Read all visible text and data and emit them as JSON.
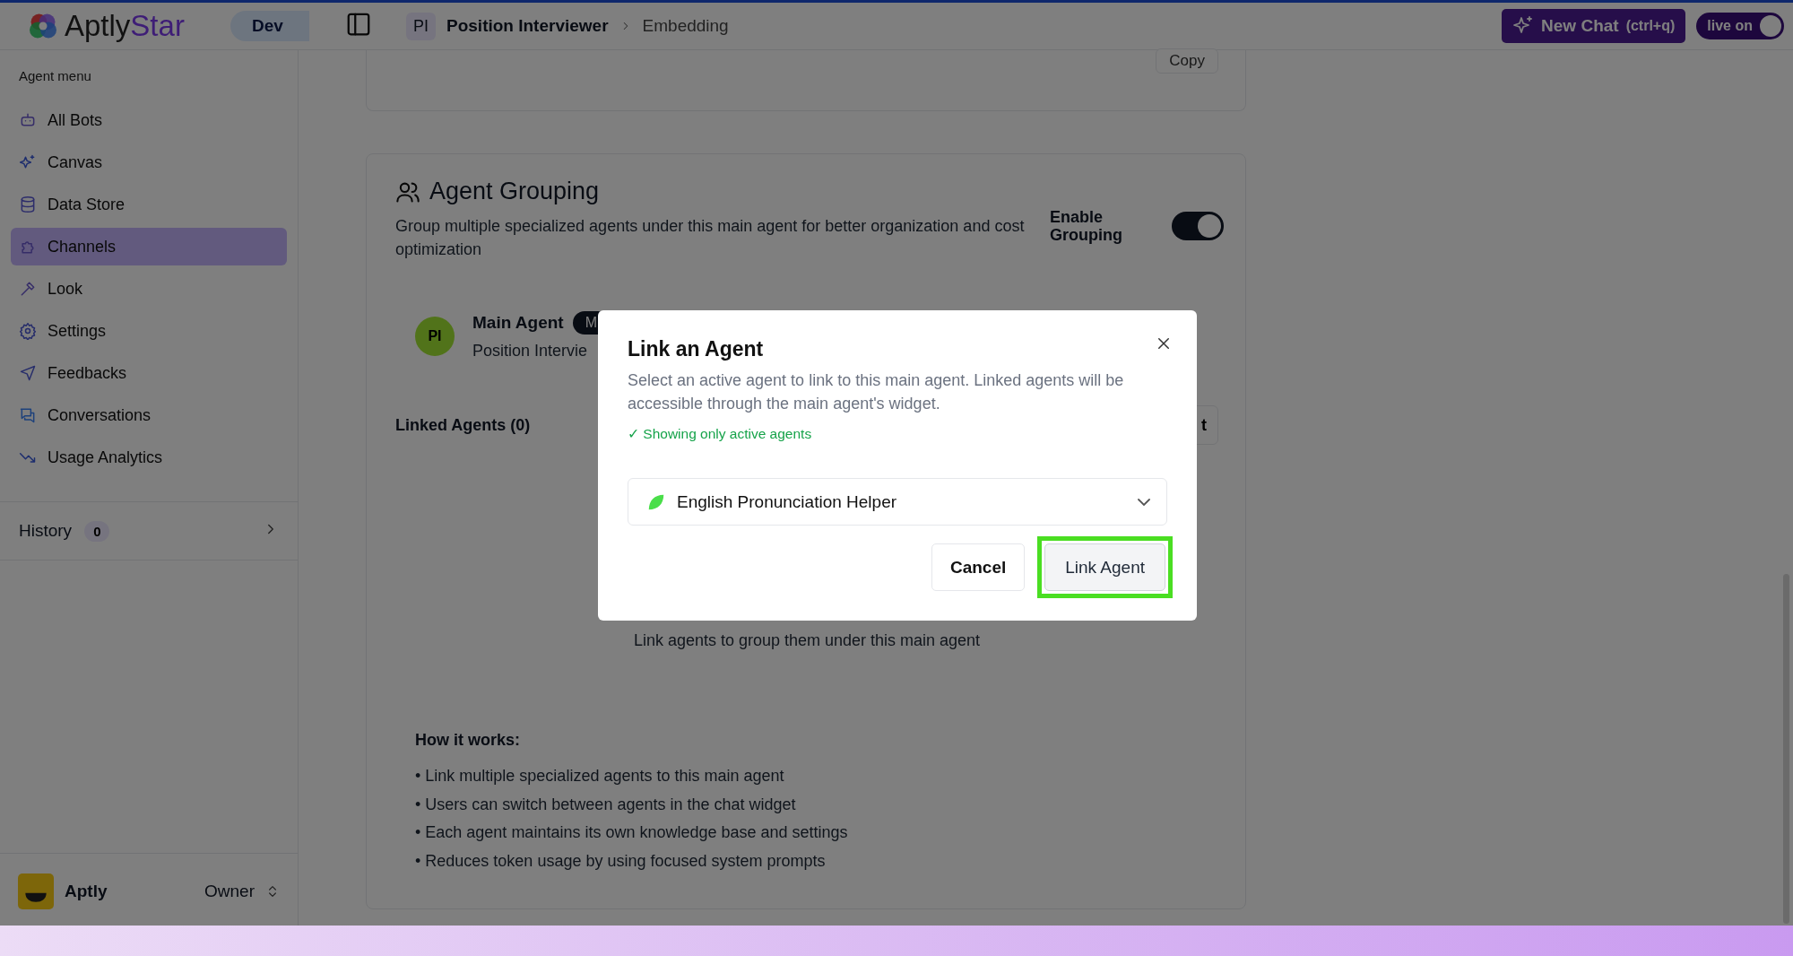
{
  "header": {
    "logo": "AptlyStar",
    "env_badge": "Dev",
    "breadcrumb": {
      "initials": "PI",
      "items": [
        "Position Interviewer",
        "Embedding"
      ]
    },
    "new_chat": {
      "label": "New Chat",
      "shortcut": "(ctrl+q)"
    },
    "live_toggle": {
      "label": "live on",
      "on": true
    }
  },
  "sidebar": {
    "section": "Agent menu",
    "items": [
      {
        "label": "All Bots",
        "selected": false
      },
      {
        "label": "Canvas",
        "selected": false
      },
      {
        "label": "Data Store",
        "selected": false
      },
      {
        "label": "Channels",
        "selected": true
      },
      {
        "label": "Look",
        "selected": false
      },
      {
        "label": "Settings",
        "selected": false
      },
      {
        "label": "Feedbacks",
        "selected": false
      },
      {
        "label": "Conversations",
        "selected": false
      },
      {
        "label": "Usage Analytics",
        "selected": false
      }
    ],
    "history": {
      "label": "History",
      "count": "0"
    },
    "user": {
      "name": "Aptly",
      "role": "Owner"
    }
  },
  "main": {
    "copy_button": "Copy",
    "grouping": {
      "title": "Agent Grouping",
      "description": "Group multiple specialized agents under this main agent for better organization and cost optimization",
      "enable_label": "Enable Grouping",
      "enabled": true,
      "main_agent": {
        "initials": "PI",
        "label": "Main Agent",
        "badge": "M",
        "name": "Position Intervie"
      },
      "linked_title": "Linked Agents (0)",
      "add_button": "t",
      "empty_text": "Link agents to group them under this main agent",
      "how_title": "How it works:",
      "how_items": [
        "• Link multiple specialized agents to this main agent",
        "• Users can switch between agents in the chat widget",
        "• Each agent maintains its own knowledge base and settings",
        "• Reduces token usage by using focused system prompts"
      ]
    }
  },
  "modal": {
    "title": "Link an Agent",
    "description": "Select an active agent to link to this main agent. Linked agents will be accessible through the main agent's widget.",
    "note": "✓ Showing only active agents",
    "select": {
      "value": "English Pronunciation Helper"
    },
    "buttons": [
      {
        "label": "Cancel",
        "kind": "secondary",
        "highlighted": false
      },
      {
        "label": "Link Agent",
        "kind": "primary",
        "highlighted": true
      }
    ]
  }
}
